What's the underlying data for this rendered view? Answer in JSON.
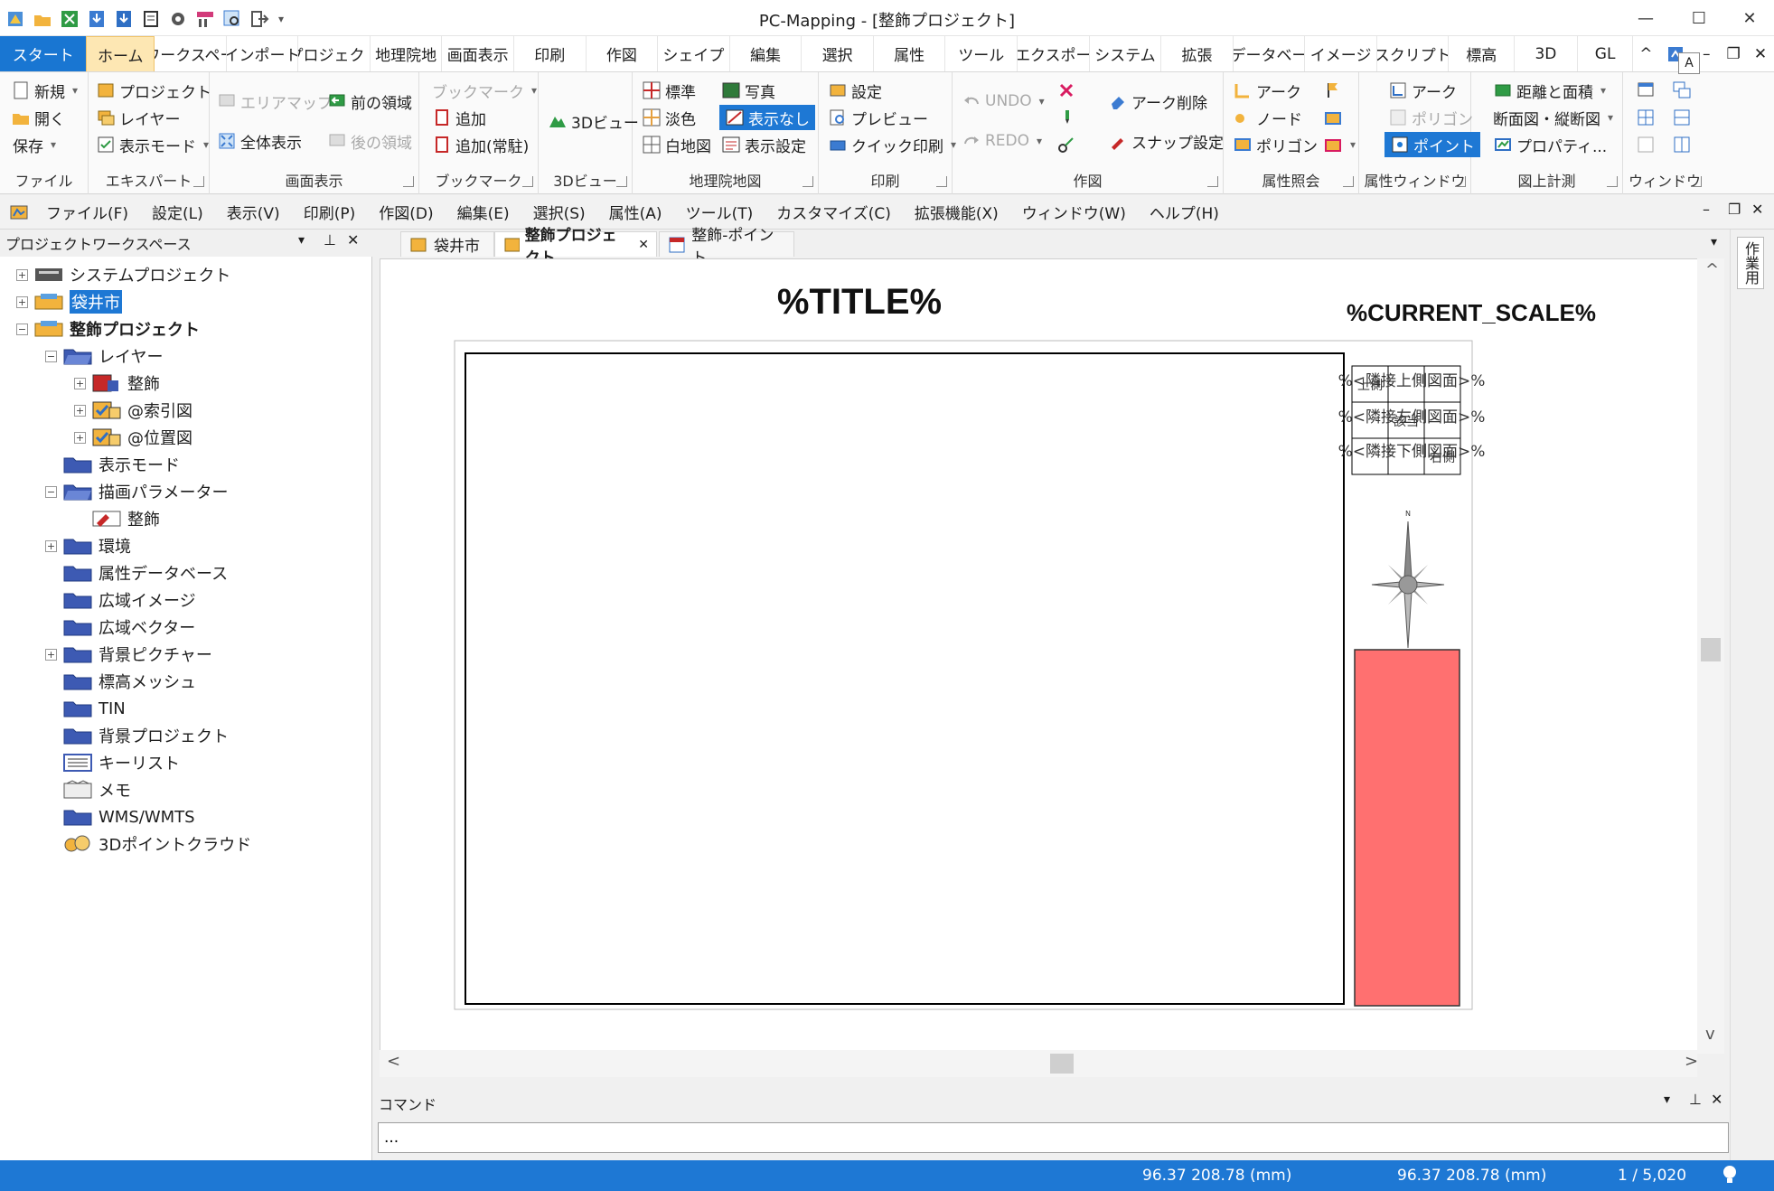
{
  "app": {
    "window_title": "PC-Mapping - [整飾プロジェクト]"
  },
  "ribbon_tabs": [
    "スタート",
    "ホーム",
    "ワークスペー",
    "インポート",
    "プロジェクト",
    "地理院地",
    "画面表示",
    "印刷",
    "作図",
    "シェイプ",
    "編集",
    "選択",
    "属性",
    "ツール",
    "エクスポー",
    "システム",
    "拡張",
    "データベー",
    "イメージ",
    "スクリプト",
    "標高",
    "3D",
    "GL"
  ],
  "ribbon": {
    "file": {
      "label": "ファイル",
      "new": "新規",
      "open": "開く",
      "save": "保存"
    },
    "explorer": {
      "label": "エキスパート",
      "project": "プロジェクト",
      "layer": "レイヤー",
      "display_mode": "表示モード"
    },
    "view": {
      "label": "画面表示",
      "area_map": "エリアマップ",
      "prev_area": "前の領域",
      "full_view": "全体表示",
      "next_area": "後の領域"
    },
    "bookmark": {
      "label": "ブックマーク",
      "bookmark": "ブックマーク",
      "add": "追加",
      "add_resident": "追加(常駐)"
    },
    "view3d": {
      "label": "3Dビュー",
      "button": "3Dビュー"
    },
    "gsi": {
      "label": "地理院地図",
      "standard": "標準",
      "pale": "淡色",
      "blank": "白地図",
      "photo": "写真",
      "none": "表示なし",
      "display_settings": "表示設定"
    },
    "print": {
      "label": "印刷",
      "settings": "設定",
      "preview": "プレビュー",
      "quick_print": "クイック印刷"
    },
    "draw": {
      "label": "作図",
      "undo": "UNDO",
      "redo": "REDO",
      "arc_delete": "アーク削除",
      "snap_settings": "スナップ設定"
    },
    "attr_query": {
      "label": "属性照会",
      "arc": "アーク",
      "node": "ノード",
      "polygon": "ポリゴン"
    },
    "attr_window": {
      "label": "属性ウィンドウ",
      "arc": "アーク",
      "polygon": "ポリゴン",
      "point": "ポイント"
    },
    "measure": {
      "label": "図上計測",
      "distance_area": "距離と面積",
      "section": "断面図・縦断図",
      "property": "プロパティ..."
    },
    "window": {
      "label": "ウィンドウ"
    }
  },
  "menubar": [
    "ファイル(F)",
    "設定(L)",
    "表示(V)",
    "印刷(P)",
    "作図(D)",
    "編集(E)",
    "選択(S)",
    "属性(A)",
    "ツール(T)",
    "カスタマイズ(C)",
    "拡張機能(X)",
    "ウィンドウ(W)",
    "ヘルプ(H)"
  ],
  "workspace": {
    "title": "プロジェクトワークスペース",
    "tree": [
      {
        "label": "システムプロジェクト",
        "level": 0,
        "exp": "+",
        "kind": "sys"
      },
      {
        "label": "袋井市",
        "level": 0,
        "exp": "+",
        "kind": "proj",
        "highlight": true
      },
      {
        "label": "整飾プロジェクト",
        "level": 0,
        "exp": "-",
        "kind": "proj",
        "bold": true
      },
      {
        "label": "レイヤー",
        "level": 1,
        "exp": "-",
        "kind": "folder-open"
      },
      {
        "label": "整飾",
        "level": 2,
        "exp": "+",
        "kind": "layer-red"
      },
      {
        "label": "@索引図",
        "level": 2,
        "exp": "+",
        "kind": "layer-check"
      },
      {
        "label": "@位置図",
        "level": 2,
        "exp": "+",
        "kind": "layer-check"
      },
      {
        "label": "表示モード",
        "level": 1,
        "exp": "",
        "kind": "folder"
      },
      {
        "label": "描画パラメーター",
        "level": 1,
        "exp": "-",
        "kind": "folder-open"
      },
      {
        "label": "整飾",
        "level": 2,
        "exp": "",
        "kind": "param"
      },
      {
        "label": "環境",
        "level": 1,
        "exp": "+",
        "kind": "folder"
      },
      {
        "label": "属性データベース",
        "level": 1,
        "exp": "",
        "kind": "folder"
      },
      {
        "label": "広域イメージ",
        "level": 1,
        "exp": "",
        "kind": "folder"
      },
      {
        "label": "広域ベクター",
        "level": 1,
        "exp": "",
        "kind": "folder"
      },
      {
        "label": "背景ピクチャー",
        "level": 1,
        "exp": "+",
        "kind": "folder"
      },
      {
        "label": "標高メッシュ",
        "level": 1,
        "exp": "",
        "kind": "folder"
      },
      {
        "label": "TIN",
        "level": 1,
        "exp": "",
        "kind": "folder"
      },
      {
        "label": "背景プロジェクト",
        "level": 1,
        "exp": "",
        "kind": "folder"
      },
      {
        "label": "キーリスト",
        "level": 1,
        "exp": "",
        "kind": "list"
      },
      {
        "label": "メモ",
        "level": 1,
        "exp": "",
        "kind": "memo"
      },
      {
        "label": "WMS/WMTS",
        "level": 1,
        "exp": "",
        "kind": "folder"
      },
      {
        "label": "3Dポイントクラウド",
        "level": 1,
        "exp": "",
        "kind": "cloud"
      }
    ]
  },
  "doc_tabs": [
    {
      "label": "袋井市",
      "active": false
    },
    {
      "label": "整飾プロジェクト",
      "active": true
    },
    {
      "label": "整飾-ポイント",
      "active": false
    }
  ],
  "canvas": {
    "title": "%TITLE%",
    "scale": "%CURRENT_SCALE%",
    "adjacent_rows": [
      "%<隣接上側図面>%",
      "%<隣接左側図面>%",
      "%<隣接下側図面>%"
    ],
    "grid_labels": [
      "上側",
      "該当",
      "右側"
    ],
    "north_label": "N",
    "fill_color": "#ff7070"
  },
  "side_panel": {
    "label": "作業用"
  },
  "command": {
    "title": "コマンド",
    "value": "..."
  },
  "status": {
    "coord1": "96.37 208.78 (mm)",
    "coord2": "96.37 208.78 (mm)",
    "scale": "1 / 5,020"
  },
  "colors": {
    "accent": "#1e78d4",
    "home_tab": "#fde7b3"
  }
}
